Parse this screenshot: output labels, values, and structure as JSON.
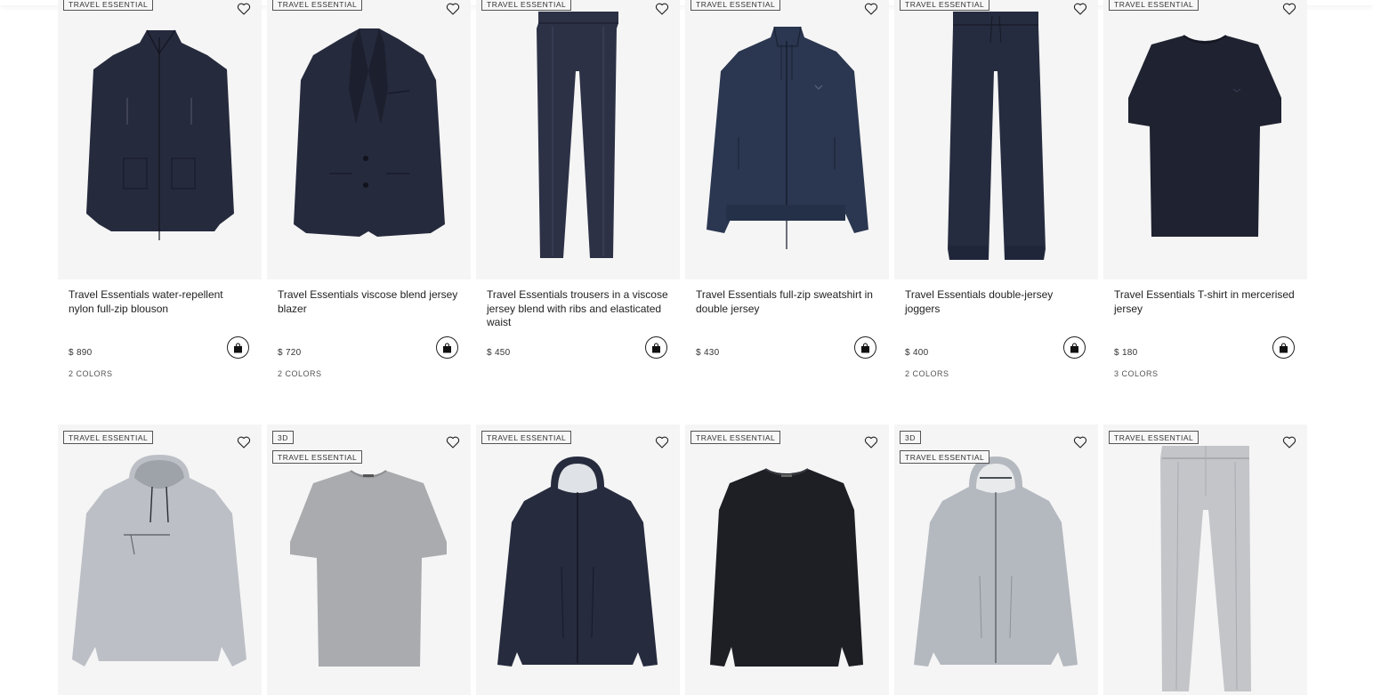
{
  "colors": {
    "navy": "#262a3d",
    "navy_mid": "#2c3448",
    "grey": "#b9bcc1",
    "black": "#1d1f24"
  },
  "row1": [
    {
      "tags": [
        "TRAVEL ESSENTIAL"
      ],
      "garment": "blouson",
      "title": "Travel Essentials water-repellent nylon full-zip blouson",
      "price": "$ 890",
      "colors": "2 COLORS"
    },
    {
      "tags": [
        "TRAVEL ESSENTIAL"
      ],
      "garment": "blazer",
      "title": "Travel Essentials viscose blend jersey blazer",
      "price": "$ 720",
      "colors": "2 COLORS"
    },
    {
      "tags": [
        "TRAVEL ESSENTIAL"
      ],
      "garment": "trousers",
      "title": "Travel Essentials trousers in a viscose jersey blend with ribs and elasticated waist",
      "price": "$ 450",
      "colors": ""
    },
    {
      "tags": [
        "TRAVEL ESSENTIAL"
      ],
      "garment": "sweatshirt",
      "title": "Travel Essentials full-zip sweatshirt in double jersey",
      "price": "$ 430",
      "colors": ""
    },
    {
      "tags": [
        "TRAVEL ESSENTIAL"
      ],
      "garment": "joggers",
      "title": "Travel Essentials double-jersey joggers",
      "price": "$ 400",
      "colors": "2 COLORS"
    },
    {
      "tags": [
        "TRAVEL ESSENTIAL"
      ],
      "garment": "tshirt",
      "title": "Travel Essentials T-shirt in mercerised jersey",
      "price": "$ 180",
      "colors": "3 COLORS"
    }
  ],
  "row2": [
    {
      "tags": [
        "TRAVEL ESSENTIAL"
      ],
      "garment": "hoodie"
    },
    {
      "tags": [
        "3D",
        "TRAVEL ESSENTIAL"
      ],
      "garment": "tshirt-grey"
    },
    {
      "tags": [
        "TRAVEL ESSENTIAL"
      ],
      "garment": "hooded-jacket"
    },
    {
      "tags": [
        "TRAVEL ESSENTIAL"
      ],
      "garment": "sweater"
    },
    {
      "tags": [
        "3D",
        "TRAVEL ESSENTIAL"
      ],
      "garment": "hooded-jacket-grey"
    },
    {
      "tags": [
        "TRAVEL ESSENTIAL"
      ],
      "garment": "trousers-grey"
    }
  ]
}
